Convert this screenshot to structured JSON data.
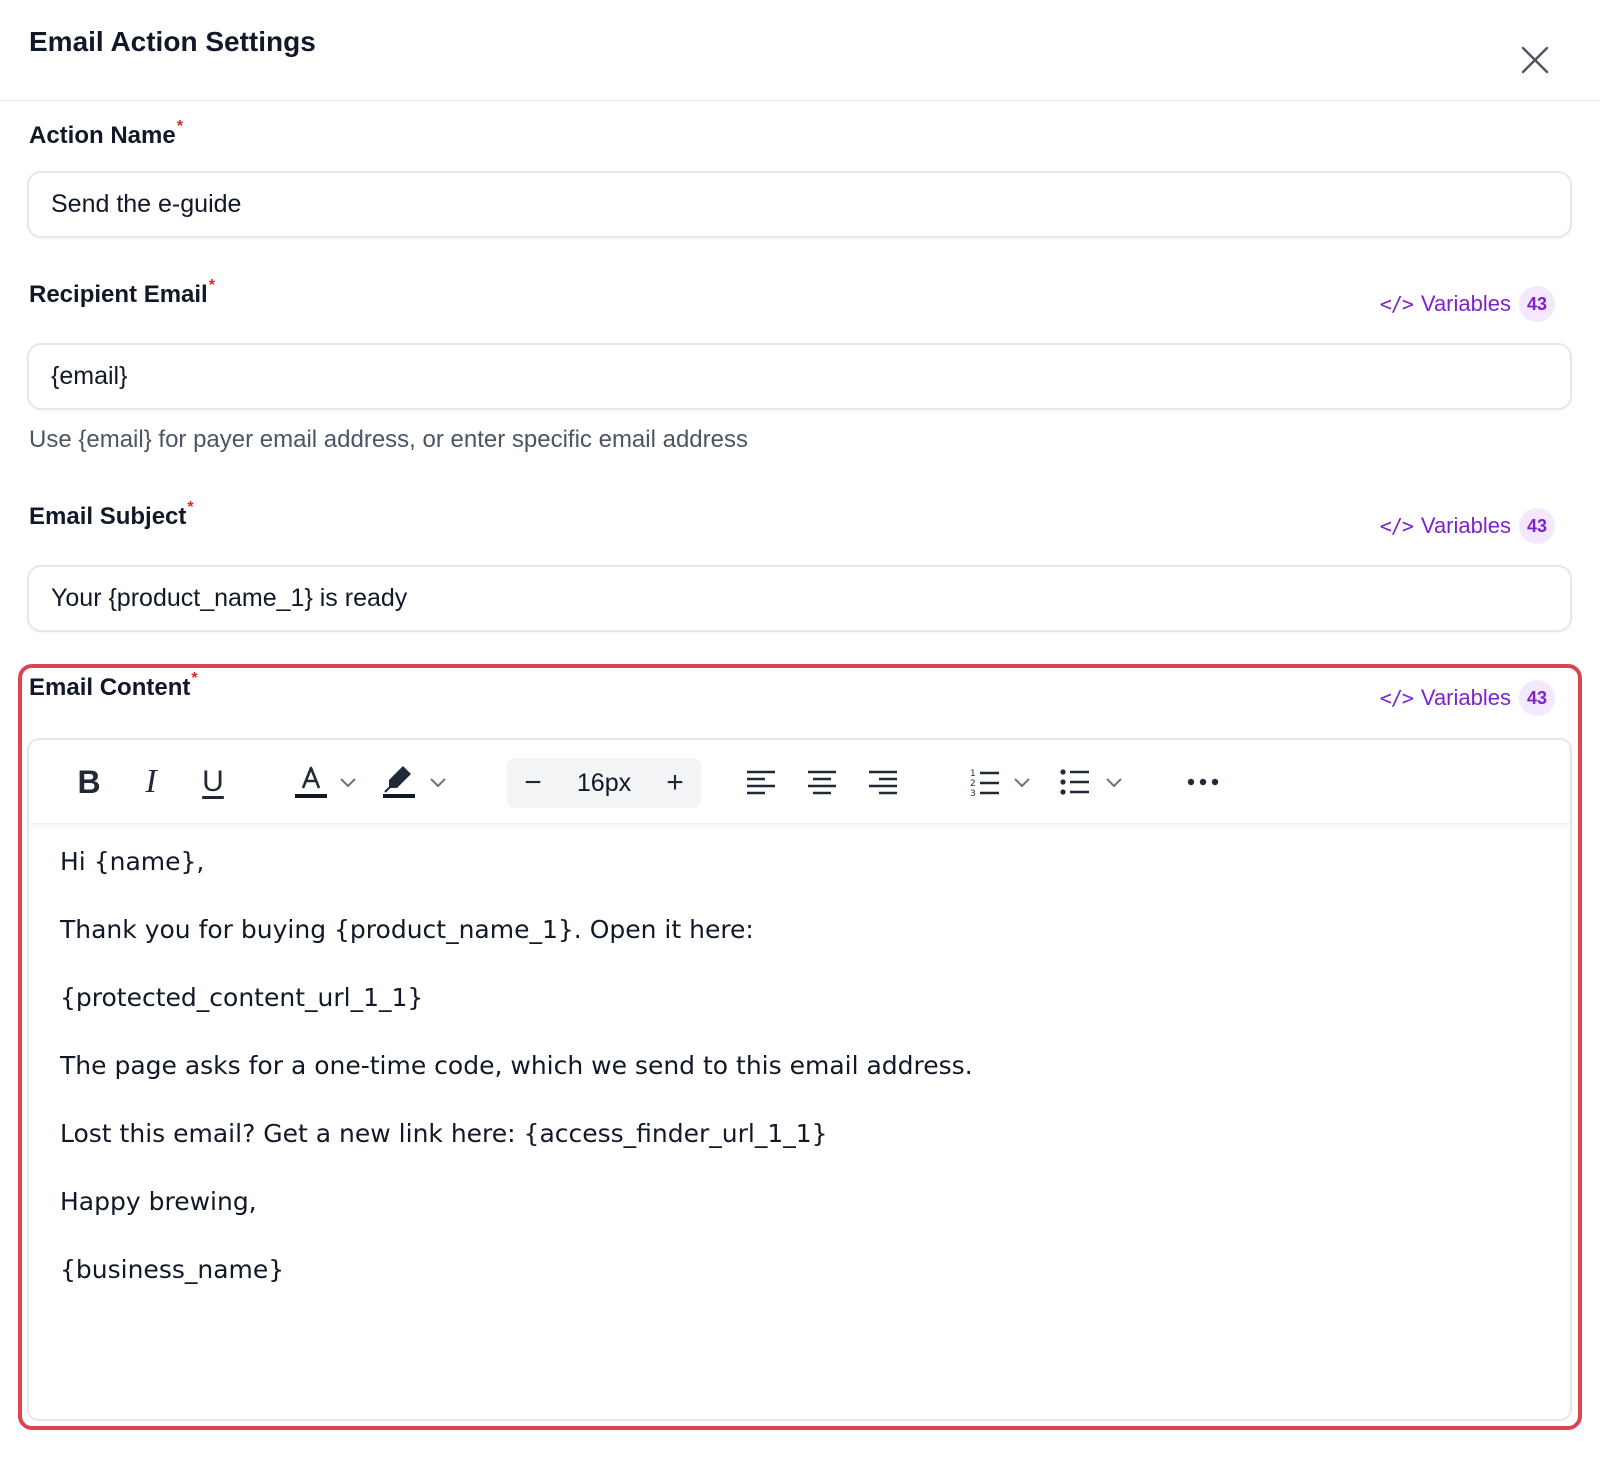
{
  "dialog": {
    "title": "Email Action Settings",
    "close_icon": "close-icon"
  },
  "fields": {
    "action_name": {
      "label": "Action Name",
      "required_mark": "*",
      "value": "Send the e-guide"
    },
    "recipient_email": {
      "label": "Recipient Email",
      "required_mark": "*",
      "value": "{email}",
      "helper": "Use {email} for payer email address, or enter specific email address"
    },
    "email_subject": {
      "label": "Email Subject",
      "required_mark": "*",
      "value": "Your {product_name_1} is ready"
    },
    "email_content": {
      "label": "Email Content",
      "required_mark": "*"
    }
  },
  "variables": {
    "label": "Variables",
    "count": "43",
    "icon": "code-icon",
    "icon_glyph": "</>"
  },
  "toolbar": {
    "bold": "B",
    "italic": "I",
    "underline": "U",
    "font_size": "16px",
    "minus": "−",
    "plus": "+",
    "icons": [
      "text-color-icon",
      "highlight-icon",
      "align-left-icon",
      "align-center-icon",
      "align-right-icon",
      "numbered-list-icon",
      "bullet-list-icon",
      "more-icon"
    ]
  },
  "editor": {
    "lines": [
      "Hi {name},",
      "Thank you for buying {product_name_1}. Open it here:",
      "{protected_content_url_1_1}",
      "The page asks for a one-time code, which we send to this email address.",
      "Lost this email? Get a new link here: {access_finder_url_1_1}",
      "Happy brewing,",
      "{business_name}"
    ]
  },
  "colors": {
    "accent": "#7e22ce",
    "required": "#dc2626",
    "highlight_border": "#dc4450"
  }
}
